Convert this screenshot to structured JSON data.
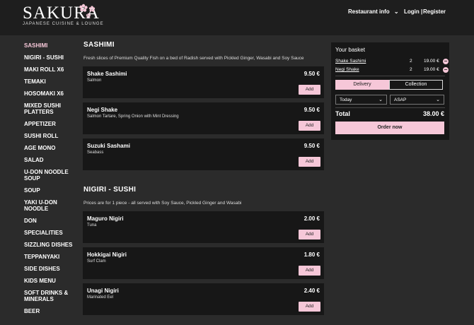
{
  "brand": {
    "name": "SAKURA",
    "tagline": "JAPANESE CUISINE & LOUNGE",
    "accent": "#f6c7d8"
  },
  "topnav": {
    "restaurant_info": "Restaurant info",
    "login": "Login |",
    "register": "Register"
  },
  "sidebar": {
    "items": [
      {
        "label": "SASHIMI"
      },
      {
        "label": "NIGIRI - SUSHI"
      },
      {
        "label": "MAKI ROLL X6"
      },
      {
        "label": "TEMAKI"
      },
      {
        "label": "HOSOMAKI X6"
      },
      {
        "label": "MIXED SUSHI PLATTERS"
      },
      {
        "label": "APPETIZER"
      },
      {
        "label": "SUSHI ROLL"
      },
      {
        "label": "AGE MONO"
      },
      {
        "label": "SALAD"
      },
      {
        "label": "U-DON NOODLE SOUP"
      },
      {
        "label": "SOUP"
      },
      {
        "label": "YAKI U-DON NOODLE"
      },
      {
        "label": "DON"
      },
      {
        "label": "SPECIALITIES"
      },
      {
        "label": "SIZZLING DISHES"
      },
      {
        "label": "TEPPANYAKI"
      },
      {
        "label": "SIDE DISHES"
      },
      {
        "label": "KIDS MENU"
      },
      {
        "label": "SOFT DRINKS & MINERALS"
      },
      {
        "label": "BEER"
      }
    ]
  },
  "menu": {
    "sashimi": {
      "title": "SASHIMI",
      "desc": "Fresh slices of Premium Quality Fish on a bed of Radish served with Pickled Ginger, Wasabi and Soy Sauce",
      "items": [
        {
          "name": "Shake Sashimi",
          "desc": "Salmon",
          "price": "9.50 €",
          "add": "Add"
        },
        {
          "name": "Negi Shake",
          "desc": "Salmon Tartare, Spring Onion with Mint Dressing",
          "price": "9.50 €",
          "add": "Add"
        },
        {
          "name": "Suzuki Sashami",
          "desc": "Seabass",
          "price": "9.50 €",
          "add": "Add"
        }
      ]
    },
    "nigiri": {
      "title": "NIGIRI - SUSHI",
      "desc": "Prices are for 1 piece - all served with Soy Sauce, Pickled Ginger and Wasabi",
      "items": [
        {
          "name": "Maguro Nigiri",
          "desc": "Tuna",
          "price": "2.00 €",
          "add": "Add"
        },
        {
          "name": "Hokkigai Nigiri",
          "desc": "Surf Clam",
          "price": "1.80 €",
          "add": "Add"
        },
        {
          "name": "Unagi Nigiri",
          "desc": "Marinated Eel",
          "price": "2.40 €",
          "add": "Add"
        }
      ]
    }
  },
  "basket": {
    "title": "Your basket",
    "lines": [
      {
        "name": "Shake Sashimi",
        "qty": "2",
        "price": "19.00 €",
        "remove": "−"
      },
      {
        "name": "Negi Shake",
        "qty": "2",
        "price": "19.00 €",
        "remove": "−"
      }
    ],
    "delivery": "Delivery",
    "collection": "Collection",
    "day": "Today",
    "time": "ASAP",
    "total_label": "Total",
    "total_value": "38.00 €",
    "order": "Order now"
  }
}
